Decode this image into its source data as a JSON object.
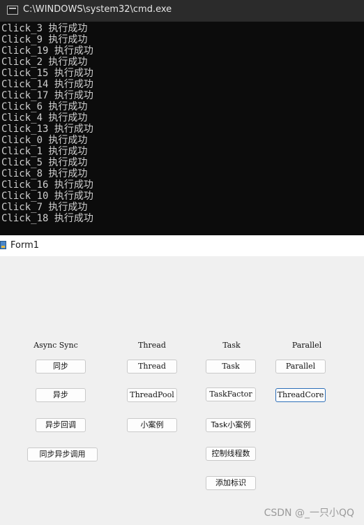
{
  "cmd": {
    "title": "C:\\WINDOWS\\system32\\cmd.exe",
    "lines": [
      "Click_3 执行成功",
      "Click_9 执行成功",
      "Click_19 执行成功",
      "Click_2 执行成功",
      "Click_15 执行成功",
      "Click_14 执行成功",
      "Click_17 执行成功",
      "Click_6 执行成功",
      "Click_4 执行成功",
      "Click_13 执行成功",
      "Click_0 执行成功",
      "Click_1 执行成功",
      "Click_5 执行成功",
      "Click_8 执行成功",
      "Click_16 执行成功",
      "Click_10 执行成功",
      "Click_7 执行成功",
      "Click_18 执行成功"
    ]
  },
  "form": {
    "title": "Form1",
    "labels": {
      "async_sync": "Async Sync",
      "thread": "Thread",
      "task": "Task",
      "parallel": "Parallel"
    },
    "buttons": {
      "sync": "同步",
      "async": "异步",
      "async_callback": "异步回调",
      "sync_async_call": "同步异步调用",
      "thread": "Thread",
      "threadpool": "ThreadPool",
      "small_case": "小案例",
      "task": "Task",
      "task_factory": "TaskFactor",
      "task_small_case": "Task小案例",
      "control_thread_count": "控制线程数",
      "add_flag": "添加标识",
      "parallel": "Parallel",
      "thread_core": "ThreadCore"
    }
  },
  "watermark": "CSDN @_一只小QQ"
}
